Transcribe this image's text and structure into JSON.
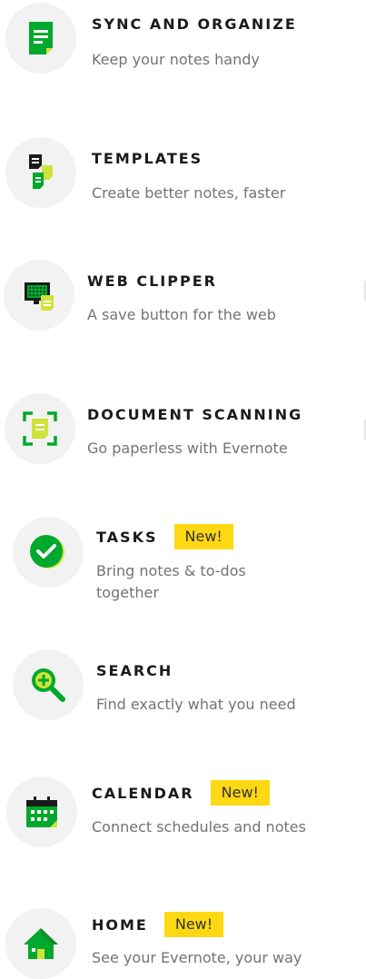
{
  "features": [
    {
      "title": "SYNC AND ORGANIZE",
      "description": "Keep your notes handy",
      "icon": "note-icon"
    },
    {
      "title": "TEMPLATES",
      "description": "Create better notes, faster",
      "icon": "templates-icon"
    },
    {
      "title": "WEB CLIPPER",
      "description": "A save button for the web",
      "icon": "web-clipper-icon"
    },
    {
      "title": "DOCUMENT SCANNING",
      "description": "Go paperless with Evernote",
      "icon": "scan-icon"
    },
    {
      "title": "TASKS",
      "badge": "New!",
      "description": "Bring notes & to-dos together",
      "icon": "checkmark-icon"
    },
    {
      "title": "SEARCH",
      "description": "Find exactly what you need",
      "icon": "search-icon"
    },
    {
      "title": "CALENDAR",
      "badge": "New!",
      "description": "Connect schedules and notes",
      "icon": "calendar-icon"
    },
    {
      "title": "HOME",
      "badge": "New!",
      "description": "See your Evernote, your way",
      "icon": "home-icon"
    }
  ],
  "colors": {
    "green": "#00a82d",
    "bright_green": "#2dbe60",
    "lime": "#cfe33a",
    "badge_yellow": "#ffd814",
    "icon_bg": "#f2f2f2"
  }
}
